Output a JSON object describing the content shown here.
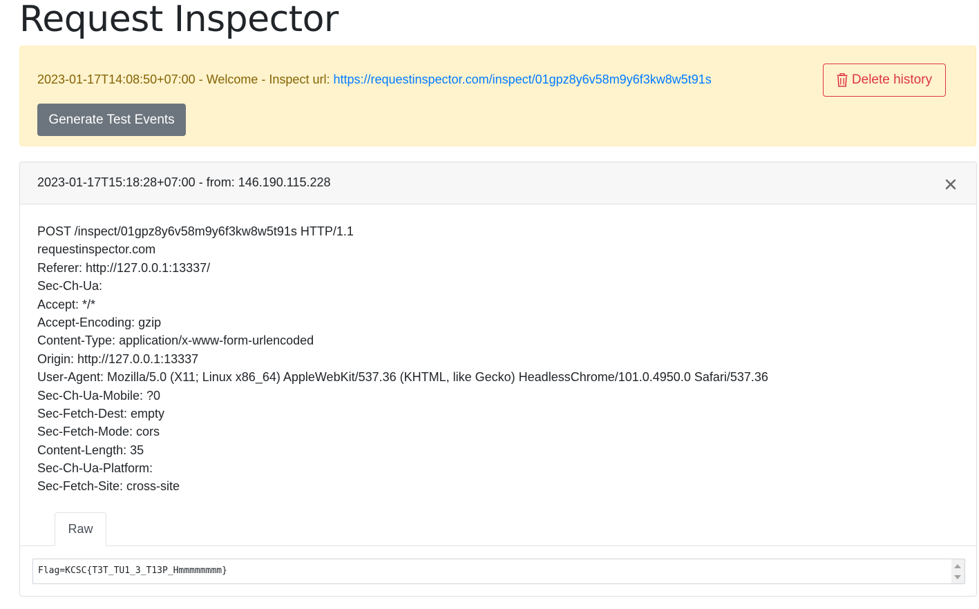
{
  "page": {
    "title": "Request Inspector"
  },
  "welcome": {
    "timestamp": "2023-01-17T14:08:50+07:00",
    "separator1": " - ",
    "label": "Welcome",
    "separator2": " - ",
    "inspect_label": "Inspect url: ",
    "inspect_url": "https://requestinspector.com/inspect/01gpz8y6v58m9y6f3kw8w5t91s",
    "delete_label": "Delete history",
    "delete_icon": "trash-icon",
    "generate_label": "Generate Test Events"
  },
  "event": {
    "header": "2023-01-17T15:18:28+07:00 - from: 146.190.115.228",
    "close_icon": "close-icon",
    "lines": [
      "POST /inspect/01gpz8y6v58m9y6f3kw8w5t91s HTTP/1.1",
      "requestinspector.com",
      "Referer: http://127.0.0.1:13337/",
      "Sec-Ch-Ua:",
      "Accept: */*",
      "Accept-Encoding: gzip",
      "Content-Type: application/x-www-form-urlencoded",
      "Origin: http://127.0.0.1:13337",
      "User-Agent: Mozilla/5.0 (X11; Linux x86_64) AppleWebKit/537.36 (KHTML, like Gecko) HeadlessChrome/101.0.4950.0 Safari/537.36",
      "Sec-Ch-Ua-Mobile: ?0",
      "Sec-Fetch-Dest: empty",
      "Sec-Fetch-Mode: cors",
      "Content-Length: 35",
      "Sec-Ch-Ua-Platform:",
      "Sec-Fetch-Site: cross-site"
    ],
    "tab_raw": "Raw",
    "body": "Flag=KCSC{T3T_TU1_3_T13P_Hmmmmmmmm}"
  },
  "colors": {
    "alert_bg": "#fff3cd",
    "alert_text": "#856404",
    "link": "#007bff",
    "danger": "#dc3545",
    "secondary": "#6c757d"
  }
}
